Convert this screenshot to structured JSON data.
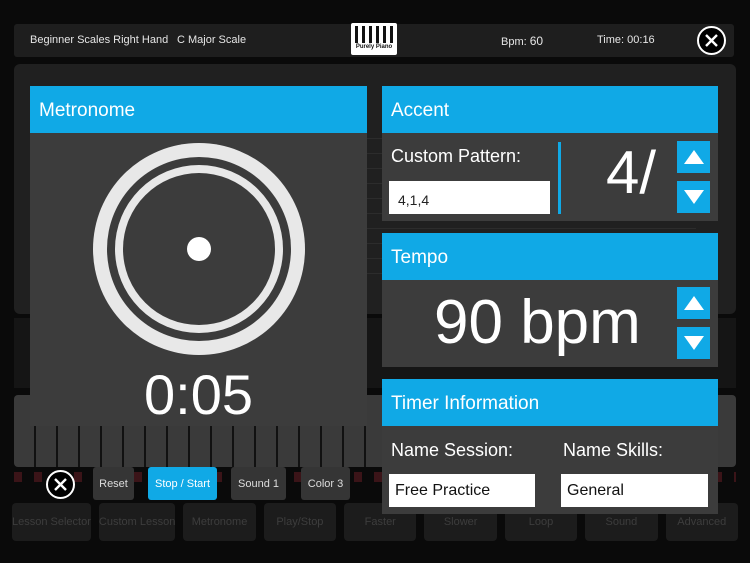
{
  "header": {
    "lesson": "Beginner Scales Right Hand",
    "scale": "C Major Scale",
    "logo_text": "Purely Piano",
    "bpm_label": "Bpm:",
    "bpm_value": "60",
    "time": "Time: 00:16"
  },
  "metronome": {
    "title": "Metronome",
    "timer": "0:05"
  },
  "accent": {
    "title": "Accent",
    "pattern_label": "Custom Pattern:",
    "pattern_value": "4,1,4",
    "time_signature": "4/"
  },
  "tempo": {
    "title": "Tempo",
    "value": "90 bpm"
  },
  "timer_info": {
    "title": "Timer Information",
    "session_label": "Name Session:",
    "skills_label": "Name Skills:",
    "session_value": "Free Practice",
    "skills_value": "General"
  },
  "controls": {
    "reset": "Reset",
    "stop_start": "Stop / Start",
    "sound": "Sound 1",
    "color": "Color 3"
  },
  "background_toolbar": [
    "Lesson Selector",
    "Custom Lesson",
    "Metronome",
    "Play/Stop",
    "Faster",
    "Slower",
    "Loop",
    "Sound",
    "Advanced"
  ],
  "colors": {
    "accent": "#10a9e6",
    "panel": "#3c3c3c",
    "background": "#000000"
  }
}
